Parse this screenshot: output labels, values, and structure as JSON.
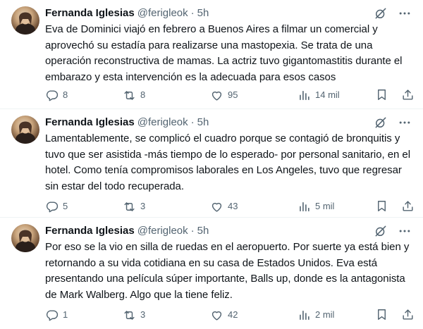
{
  "tweets": [
    {
      "author_name": "Fernanda Iglesias",
      "handle": "@ferigleok",
      "separator": "·",
      "time": "5h",
      "text": "Eva de Dominici viajó en febrero a Buenos Aires a filmar un comercial y aprovechó su estadía para realizarse una mastopexia. Se trata de una operación reconstructiva de mamas. La actriz tuvo gigantomastitis durante el embarazo y esta intervención es la adecuada para esos casos",
      "replies": "8",
      "reposts": "8",
      "likes": "95",
      "views": "14 mil"
    },
    {
      "author_name": "Fernanda Iglesias",
      "handle": "@ferigleok",
      "separator": "·",
      "time": "5h",
      "text": "Lamentablemente, se complicó el cuadro porque se contagió de bronquitis y tuvo que ser asistida -más tiempo de lo esperado- por personal sanitario, en el hotel. Como tenía compromisos laborales en Los Angeles, tuvo que regresar sin estar del todo recuperada.",
      "replies": "5",
      "reposts": "3",
      "likes": "43",
      "views": "5 mil"
    },
    {
      "author_name": "Fernanda Iglesias",
      "handle": "@ferigleok",
      "separator": "·",
      "time": "5h",
      "text": "Por eso se la vio en silla de ruedas en el aeropuerto. Por suerte ya está bien y retornando a su vida cotidiana en su casa de Estados Unidos. Eva está presentando una película súper importante, Balls up, donde es la antagonista de Mark Walberg. Algo que la tiene feliz.",
      "replies": "1",
      "reposts": "3",
      "likes": "42",
      "views": "2 mil"
    }
  ],
  "icons": {
    "grok": "grok-icon",
    "more": "more-icon",
    "reply": "reply-icon",
    "repost": "repost-icon",
    "like": "like-icon",
    "views": "views-icon",
    "bookmark": "bookmark-icon",
    "share": "share-icon"
  },
  "colors": {
    "text": "#0f1419",
    "secondary": "#536471",
    "divider": "#eff3f4",
    "background": "#ffffff"
  }
}
